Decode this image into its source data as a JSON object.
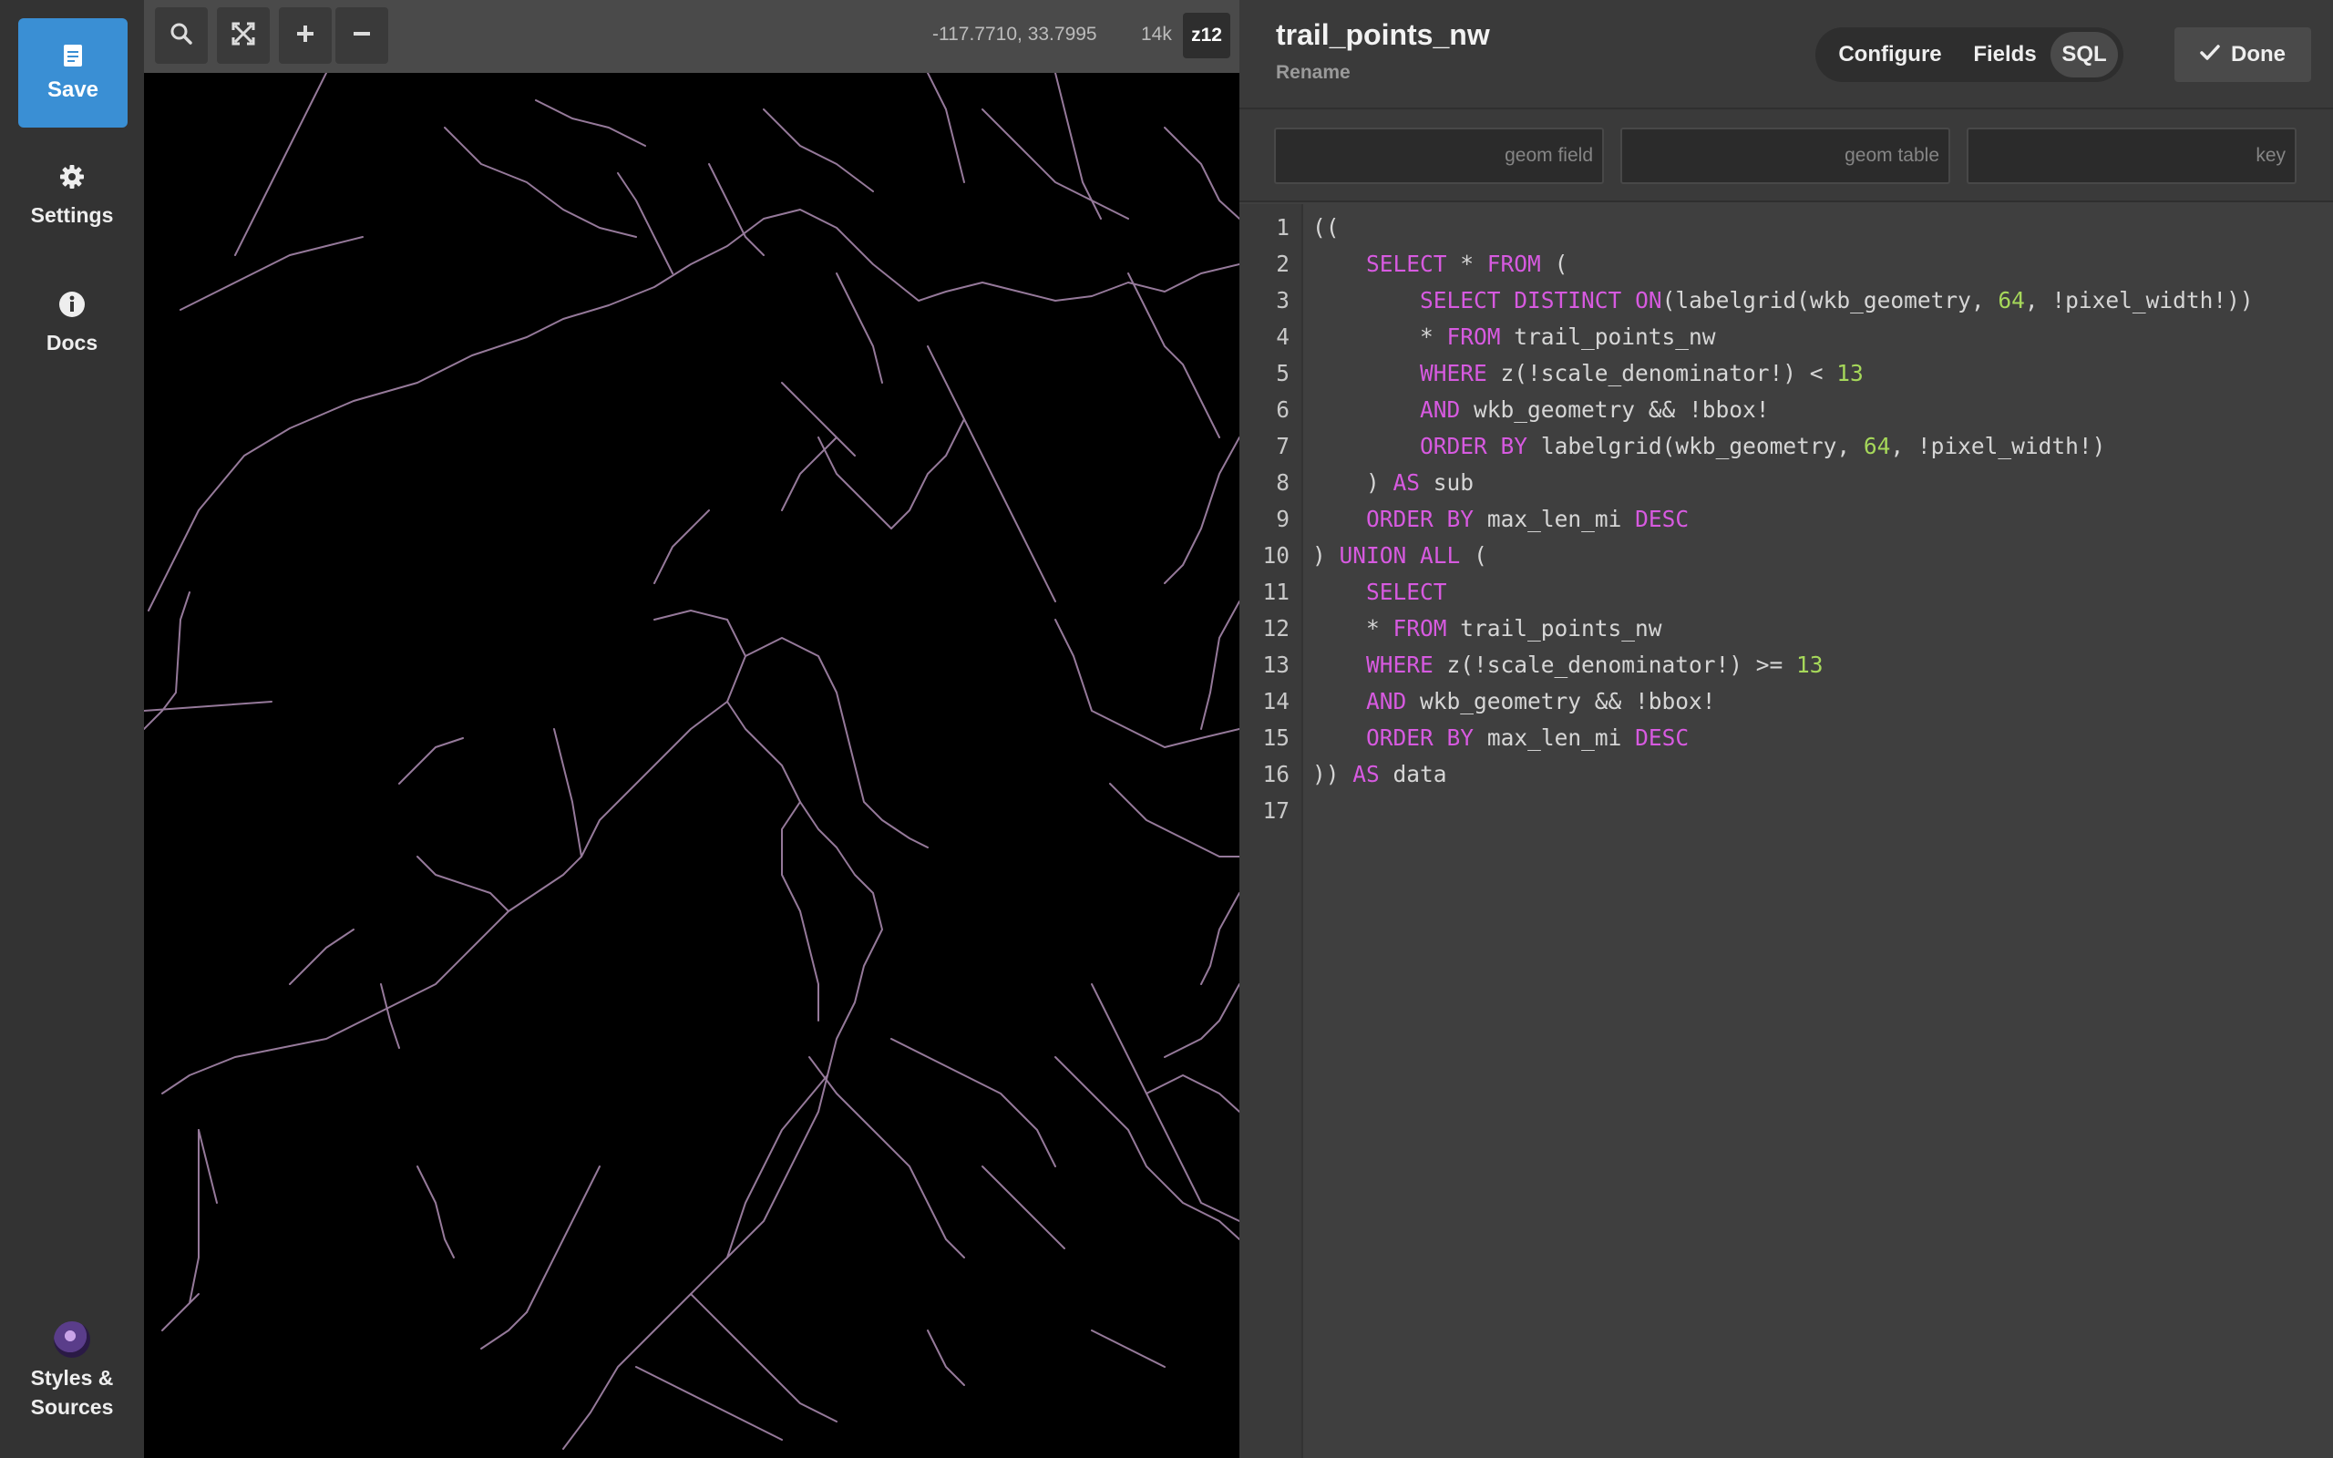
{
  "nav": {
    "save": "Save",
    "settings": "Settings",
    "docs": "Docs",
    "styles": "Styles & Sources"
  },
  "map": {
    "coords": "-117.7710, 33.7995",
    "scale": "14k",
    "zoom": "z12",
    "trail_color": "#b08fb5"
  },
  "panel": {
    "title": "trail_points_nw",
    "rename": "Rename",
    "tabs": [
      "Configure",
      "Fields",
      "SQL"
    ],
    "active_tab": "SQL",
    "done": "Done",
    "fields": [
      {
        "value": "",
        "placeholder": "geom field"
      },
      {
        "value": "",
        "placeholder": "geom table"
      },
      {
        "value": "",
        "placeholder": "key"
      }
    ]
  },
  "sql_lines": [
    "((",
    "    SELECT * FROM (",
    "        SELECT DISTINCT ON(labelgrid(wkb_geometry, 64, !pixel_width!))",
    "        * FROM trail_points_nw",
    "        WHERE z(!scale_denominator!) < 13",
    "        AND wkb_geometry && !bbox!",
    "        ORDER BY labelgrid(wkb_geometry, 64, !pixel_width!)",
    "    ) AS sub",
    "    ORDER BY max_len_mi DESC",
    ") UNION ALL (",
    "    SELECT",
    "    * FROM trail_points_nw",
    "    WHERE z(!scale_denominator!) >= 13",
    "    AND wkb_geometry && !bbox!",
    "    ORDER BY max_len_mi DESC",
    ")) AS data",
    ""
  ],
  "colors": {
    "accent": "#3a8fd4",
    "keyword": "#d75ae0",
    "number": "#a6d85a"
  }
}
